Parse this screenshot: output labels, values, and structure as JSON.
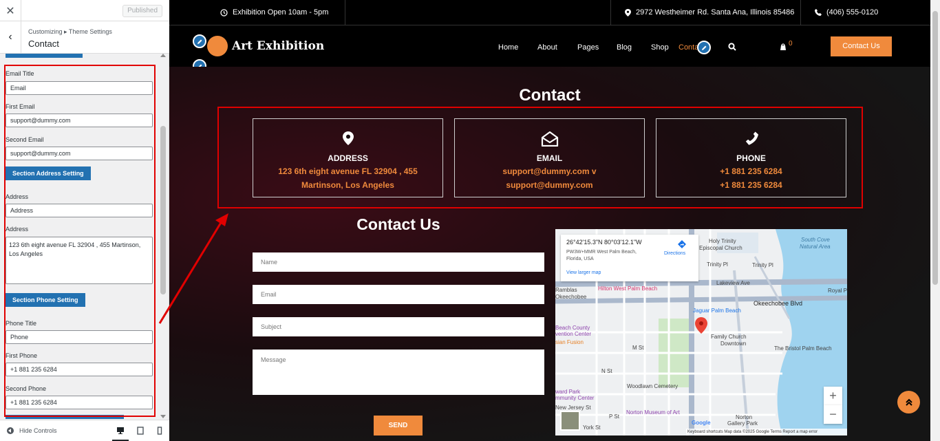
{
  "sidebar": {
    "close_icon": "close-icon",
    "published_label": "Published",
    "breadcrumb": "Customizing ▸ Theme Settings",
    "title": "Contact",
    "fields": {
      "email_title_label": "Email Title",
      "email_title_value": "Email",
      "first_email_label": "First Email",
      "first_email_value": "support@dummy.com",
      "second_email_label": "Second Email",
      "second_email_value": "support@dummy.com",
      "section_address_button": "Section Address Setting",
      "address_title_label": "Address",
      "address_title_value": "Address",
      "address_label": "Address",
      "address_value": "123 6th eight avenue FL 32904 , 455 Martinson, Los Angeles",
      "section_phone_button": "Section Phone Setting",
      "phone_title_label": "Phone Title",
      "phone_title_value": "Phone",
      "first_phone_label": "First Phone",
      "first_phone_value": "+1 881 235 6284",
      "second_phone_label": "Second Phone",
      "second_phone_value": "+1 881 235 6284"
    },
    "footer": {
      "hide_controls": "Hide Controls",
      "devices": [
        "desktop-icon",
        "tablet-icon",
        "mobile-icon"
      ]
    }
  },
  "topbar": {
    "hours": "Exhibition Open 10am - 5pm",
    "address": "2972 Westheimer Rd. Santa Ana, Illinois 85486",
    "phone": "(406) 555-0120"
  },
  "navbar": {
    "logo_text": "Art Exhibition",
    "items": [
      "Home",
      "About",
      "Pages",
      "Blog",
      "Shop",
      "Contact"
    ],
    "active": "Contact",
    "cart_count": "0",
    "cta_label": "Contact Us"
  },
  "contact_section": {
    "title": "Contact",
    "cards": [
      {
        "icon": "location-pin-icon",
        "title": "ADDRESS",
        "line1": "123 6th eight avenue FL 32904 , 455",
        "line2": "Martinson, Los Angeles"
      },
      {
        "icon": "envelope-open-icon",
        "title": "EMAIL",
        "line1": "support@dummy.com v",
        "line2": "support@dummy.com"
      },
      {
        "icon": "phone-icon",
        "title": "PHONE",
        "line1": "+1 881 235 6284",
        "line2": "+1 881 235 6284"
      }
    ]
  },
  "contact_form": {
    "title": "Contact Us",
    "name_placeholder": "Name",
    "email_placeholder": "Email",
    "subject_placeholder": "Subject",
    "message_placeholder": "Message",
    "send_label": "SEND"
  },
  "map": {
    "coords": "26°42'15.3\"N 80°03'12.1\"W",
    "place": "PW3W+MMR West Palm Beach, Florida, USA",
    "directions": "Directions",
    "view_larger": "View larger map",
    "labels": {
      "holy_trinity": "Holy Trinity",
      "episcopal": "Episcopal Church",
      "south_cove": "South Cove",
      "natural_area": "Natural Area",
      "trinity_pl1": "Trinity Pl",
      "trinity_pl2": "Trinity Pl",
      "lakeview": "Lakeview Ave",
      "royal": "Royal P",
      "ramblas": "Ramblas",
      "okeechobee_left": "Okeechobee",
      "hilton": "Hilton West Palm Beach",
      "okeechobee_blvd": "Okeechobee Blvd",
      "jaguar": "Jaguar Palm Beach",
      "beach_county": "Beach County",
      "vention_center": "vention Center",
      "asian_fusion": "sian Fusion",
      "family_church": "Family Church",
      "downtown": "Downtown",
      "bristol": "The Bristol Palm Beach",
      "m_st": "M St",
      "n_st": "N St",
      "woodlawn": "Woodlawn Cemetery",
      "ward_park": "ward Park",
      "community_center": "mmunity Center",
      "new_jersey": "New Jersey St",
      "p_st": "P St",
      "norton_museum": "Norton Museum of Art",
      "norton_gallery1": "Norton",
      "norton_gallery2": "Gallery Park",
      "york": "York St",
      "google": "Google"
    },
    "zoom_in": "+",
    "zoom_out": "−",
    "footer": "Keyboard shortcuts   Map data ©2025 Google   Terms   Report a map error"
  },
  "scroll_top_icon": "double-chevron-up-icon",
  "colors": {
    "accent": "#f08a3c",
    "wp_blue": "#2271b1",
    "highlight_red": "#e10000"
  }
}
